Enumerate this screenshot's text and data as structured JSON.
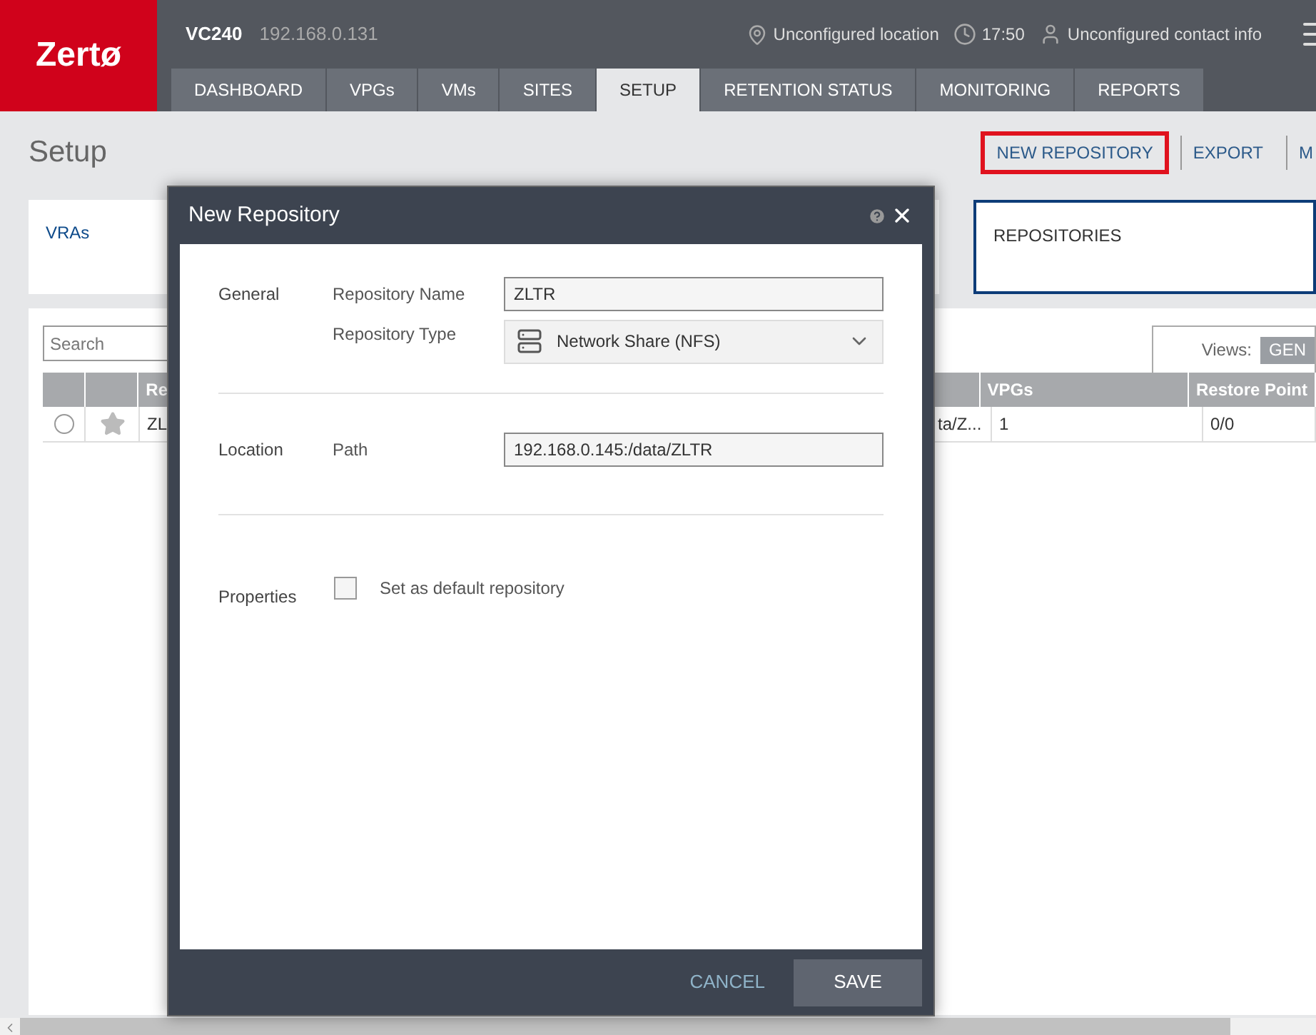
{
  "header": {
    "logo": "Zertø",
    "site_name": "VC240",
    "site_ip": "192.168.0.131",
    "location": "Unconfigured location",
    "time": "17:50",
    "contact": "Unconfigured contact info",
    "tabs": [
      {
        "label": "DASHBOARD",
        "selected": false
      },
      {
        "label": "VPGs",
        "selected": false
      },
      {
        "label": "VMs",
        "selected": false
      },
      {
        "label": "SITES",
        "selected": false
      },
      {
        "label": "SETUP",
        "selected": true
      },
      {
        "label": "RETENTION STATUS",
        "selected": false
      },
      {
        "label": "MONITORING",
        "selected": false
      },
      {
        "label": "REPORTS",
        "selected": false
      }
    ]
  },
  "page": {
    "title": "Setup",
    "actions": [
      {
        "label": "NEW REPOSITORY",
        "highlighted": true
      },
      {
        "label": "EXPORT",
        "highlighted": false
      },
      {
        "label": "M",
        "highlighted": false
      }
    ],
    "cards": [
      {
        "label": "VRAs",
        "selected": false
      },
      {
        "label": "REPOSITORIES",
        "selected": true
      }
    ],
    "search": {
      "placeholder": "Search"
    },
    "views": {
      "label": "Views:",
      "button": "GEN"
    },
    "table": {
      "columns": [
        {
          "label": "Re"
        },
        {},
        {
          "label": "VPGs"
        },
        {
          "label": "Restore Point"
        }
      ],
      "rows": [
        {
          "selected": false,
          "favorite": false,
          "cells": [
            "ZL",
            "ta/Z...",
            "1",
            "0/0"
          ]
        }
      ]
    }
  },
  "dialog": {
    "title": "New Repository",
    "sections": [
      {
        "title": "General",
        "fields": [
          {
            "kind": "text",
            "label": "Repository Name",
            "value": "ZLTR"
          },
          {
            "kind": "select",
            "label": "Repository Type",
            "value": "Network Share (NFS)"
          }
        ]
      },
      {
        "title": "Location",
        "fields": [
          {
            "kind": "text",
            "label": "Path",
            "value": "192.168.0.145:/data/ZLTR"
          }
        ]
      },
      {
        "title": "Properties",
        "fields": [
          {
            "kind": "checkbox",
            "label": "Set as default repository",
            "checked": false
          }
        ]
      }
    ],
    "buttons": [
      {
        "kind": "link",
        "label": "CANCEL"
      },
      {
        "kind": "primary",
        "label": "SAVE"
      }
    ]
  }
}
